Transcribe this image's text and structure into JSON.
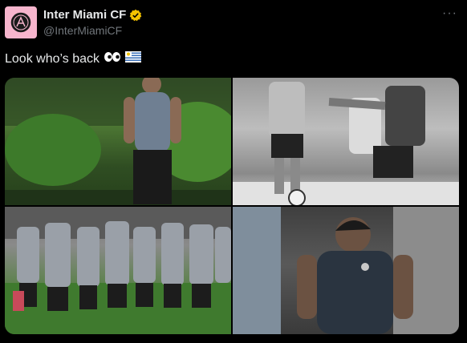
{
  "account": {
    "display_name": "Inter Miami CF",
    "handle": "@InterMiamiCF",
    "verified_badge_color": "#f4c300",
    "avatar_bg": "#f7b5cd",
    "avatar_icon": "inter-miami-crest-icon"
  },
  "menu": {
    "more_label": "···"
  },
  "tweet": {
    "text": "Look who’s back",
    "emoji": [
      "eyes-emoji",
      "uruguay-flag-emoji"
    ]
  },
  "media": {
    "photos": [
      {
        "name": "photo-player-smiling"
      },
      {
        "name": "photo-player-kicking-ball"
      },
      {
        "name": "photo-team-huddle"
      },
      {
        "name": "photo-player-training"
      }
    ]
  }
}
